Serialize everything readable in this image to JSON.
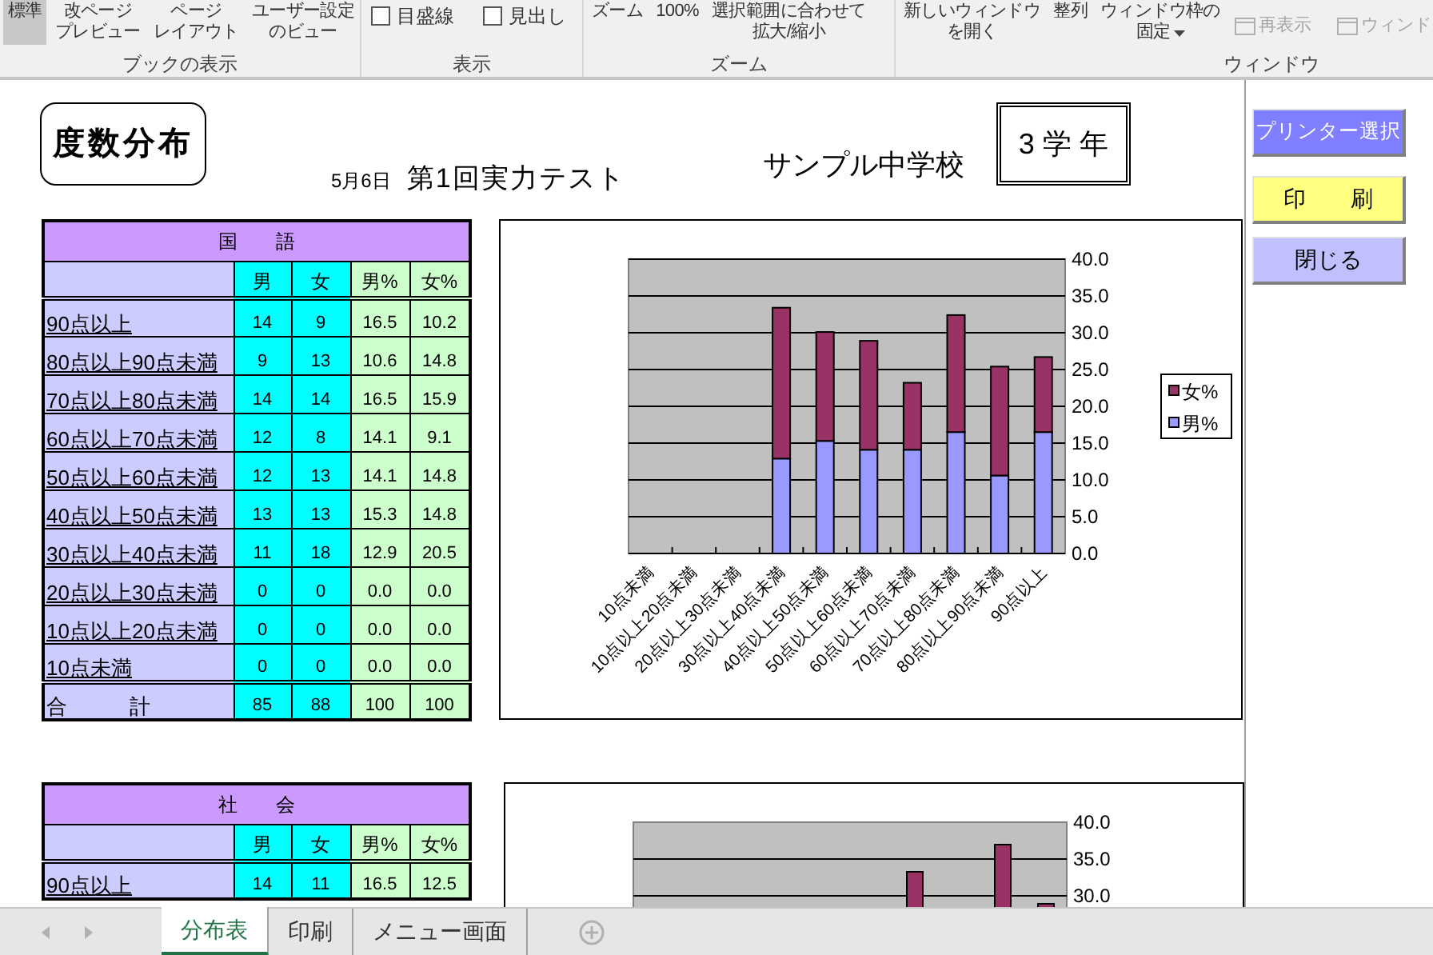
{
  "ribbon": {
    "groups": [
      {
        "label": "ブックの表示",
        "items": [
          {
            "kind": "button",
            "lines": [
              "標準"
            ],
            "selected": true
          },
          {
            "kind": "button",
            "lines": [
              "改ページ",
              "プレビュー"
            ],
            "selected": false
          },
          {
            "kind": "button",
            "lines": [
              "ページ",
              "レイアウト"
            ],
            "selected": false
          },
          {
            "kind": "button",
            "lines": [
              "ユーザー設定",
              "のビュー"
            ],
            "selected": false
          }
        ]
      },
      {
        "label": "表示",
        "items": [
          {
            "kind": "checkbox",
            "label": "目盛線",
            "checked": false
          },
          {
            "kind": "checkbox",
            "label": "見出し",
            "checked": false
          }
        ]
      },
      {
        "label": "ズーム",
        "items": [
          {
            "kind": "button",
            "lines": [
              "ズーム"
            ],
            "selected": false
          },
          {
            "kind": "button",
            "lines": [
              "100%"
            ],
            "selected": false
          },
          {
            "kind": "button",
            "lines": [
              "選択範囲に合わせて",
              "拡大/縮小"
            ],
            "selected": false
          }
        ]
      },
      {
        "label": "ウィンドウ",
        "items": [
          {
            "kind": "button",
            "lines": [
              "新しいウィンドウ",
              "を開く"
            ],
            "selected": false
          },
          {
            "kind": "button",
            "lines": [
              "整列"
            ],
            "selected": false
          },
          {
            "kind": "button",
            "lines": [
              "ウィンドウ枠の",
              "固定"
            ],
            "selected": false,
            "dropdown": true
          },
          {
            "kind": "icon_button",
            "label": "再表示",
            "disabled": true
          },
          {
            "kind": "icon_button",
            "label": "ウィンド",
            "disabled": true
          }
        ]
      }
    ]
  },
  "sheet": {
    "title": "度数分布",
    "test_date": "5月6日",
    "test_name": "第1回実力テスト",
    "school": "サンプル中学校",
    "grade": "3 学 年",
    "sections": [
      {
        "subject": "国　　語",
        "columns": [
          "男",
          "女",
          "男%",
          "女%"
        ],
        "rows": [
          {
            "label": "90点以上",
            "cells": [
              "14",
              "9",
              "16.5",
              "10.2"
            ]
          },
          {
            "label": "80点以上90点未満",
            "cells": [
              "9",
              "13",
              "10.6",
              "14.8"
            ]
          },
          {
            "label": "70点以上80点未満",
            "cells": [
              "14",
              "14",
              "16.5",
              "15.9"
            ]
          },
          {
            "label": "60点以上70点未満",
            "cells": [
              "12",
              "8",
              "14.1",
              "9.1"
            ]
          },
          {
            "label": "50点以上60点未満",
            "cells": [
              "12",
              "13",
              "14.1",
              "14.8"
            ]
          },
          {
            "label": "40点以上50点未満",
            "cells": [
              "13",
              "13",
              "15.3",
              "14.8"
            ]
          },
          {
            "label": "30点以上40点未満",
            "cells": [
              "11",
              "18",
              "12.9",
              "20.5"
            ]
          },
          {
            "label": "20点以上30点未満",
            "cells": [
              "0",
              "0",
              "0.0",
              "0.0"
            ]
          },
          {
            "label": "10点以上20点未満",
            "cells": [
              "0",
              "0",
              "0.0",
              "0.0"
            ]
          },
          {
            "label": "10点未満",
            "cells": [
              "0",
              "0",
              "0.0",
              "0.0"
            ]
          }
        ],
        "total": {
          "label": "合　　　計",
          "cells": [
            "85",
            "88",
            "100",
            "100"
          ]
        },
        "chart_data": {
          "type": "bar",
          "stacked": true,
          "categories": [
            "10点未満",
            "10点以上20点未満",
            "20点以上30点未満",
            "30点以上40点未満",
            "40点以上50点未満",
            "50点以上60点未満",
            "60点以上70点未満",
            "70点以上80点未満",
            "80点以上90点未満",
            "90点以上"
          ],
          "series": [
            {
              "name": "男%",
              "color": "#9999ff",
              "values": [
                0,
                0,
                0,
                12.9,
                15.3,
                14.1,
                14.1,
                16.5,
                10.6,
                16.5
              ]
            },
            {
              "name": "女%",
              "color": "#993366",
              "values": [
                0,
                0,
                0,
                20.5,
                14.8,
                14.8,
                9.1,
                15.9,
                14.8,
                10.2
              ]
            }
          ],
          "ylim": [
            0,
            40
          ],
          "grid": true,
          "legend": true,
          "yticks": [
            {
              "value": 0,
              "label": "0.0"
            },
            {
              "value": 5,
              "label": "5.0"
            },
            {
              "value": 10,
              "label": "10.0"
            },
            {
              "value": 15,
              "label": "15.0"
            },
            {
              "value": 20,
              "label": "20.0"
            },
            {
              "value": 25,
              "label": "25.0"
            },
            {
              "value": 30,
              "label": "30.0"
            },
            {
              "value": 35,
              "label": "35.0"
            },
            {
              "value": 40,
              "label": "40.0"
            }
          ]
        }
      },
      {
        "subject": "社　　会",
        "columns": [
          "男",
          "女",
          "男%",
          "女%"
        ],
        "rows": [
          {
            "label": "90点以上",
            "cells": [
              "14",
              "11",
              "16.5",
              "12.5"
            ]
          }
        ],
        "chart_axis_labels": [
          "40.0",
          "35.0",
          "30.0"
        ]
      }
    ]
  },
  "buttons": [
    {
      "label": "プリンター選択",
      "kind": "printer"
    },
    {
      "label": "印　　刷",
      "kind": "print"
    },
    {
      "label": "閉じる",
      "kind": "close"
    }
  ],
  "sheet_tabs": [
    {
      "label": "分布表",
      "selected": true
    },
    {
      "label": "印刷",
      "selected": false
    },
    {
      "label": "メニュー画面",
      "selected": false
    }
  ]
}
